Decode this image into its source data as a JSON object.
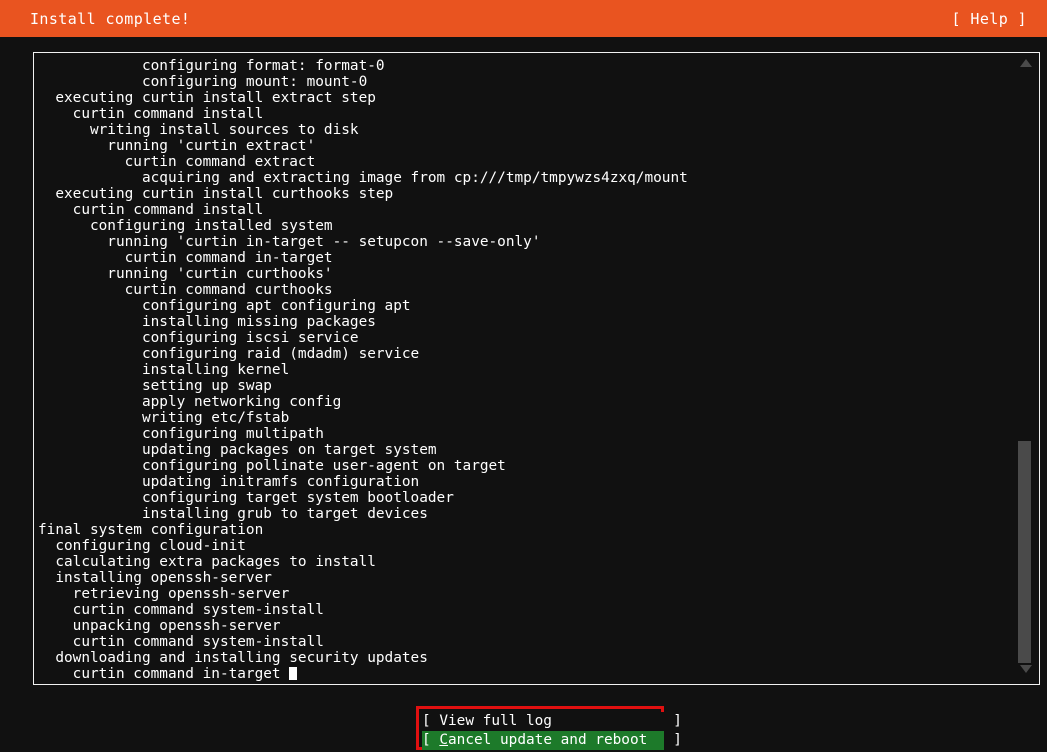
{
  "header": {
    "title": "Install complete!",
    "help_label": "[ Help ]",
    "background_color": "#e95420",
    "text_color": "#ffffff"
  },
  "log": {
    "lines": [
      "            configuring format: format-0",
      "            configuring mount: mount-0",
      "  executing curtin install extract step",
      "    curtin command install",
      "      writing install sources to disk",
      "        running 'curtin extract'",
      "          curtin command extract",
      "            acquiring and extracting image from cp:///tmp/tmpywzs4zxq/mount",
      "  executing curtin install curthooks step",
      "    curtin command install",
      "      configuring installed system",
      "        running 'curtin in-target -- setupcon --save-only'",
      "          curtin command in-target",
      "        running 'curtin curthooks'",
      "          curtin command curthooks",
      "            configuring apt configuring apt",
      "            installing missing packages",
      "            configuring iscsi service",
      "            configuring raid (mdadm) service",
      "            installing kernel",
      "            setting up swap",
      "            apply networking config",
      "            writing etc/fstab",
      "            configuring multipath",
      "            updating packages on target system",
      "            configuring pollinate user-agent on target",
      "            updating initramfs configuration",
      "            configuring target system bootloader",
      "            installing grub to target devices",
      "final system configuration",
      "  configuring cloud-init",
      "  calculating extra packages to install",
      "  installing openssh-server",
      "    retrieving openssh-server",
      "    curtin command system-install",
      "    unpacking openssh-server",
      "    curtin command system-install",
      "  downloading and installing security updates",
      "    curtin command in-target "
    ],
    "cursor_visible": true,
    "text_color": "#ffffff",
    "background_color": "#111111"
  },
  "scrollbar": {
    "up_arrow": "scroll-up-arrow",
    "down_arrow": "scroll-down-arrow",
    "thumb_color": "#4a4a4a"
  },
  "buttons": {
    "annotation_color": "#e01010",
    "selected_background": "#1d7a2a",
    "items": [
      {
        "bracket_left": "[",
        "label": " View full log",
        "bracket_right": "]",
        "selected": false,
        "hotkey": ""
      },
      {
        "bracket_left": "[",
        "label": " Cancel update and reboot",
        "bracket_right": "]",
        "selected": true,
        "hotkey": "C"
      }
    ]
  }
}
